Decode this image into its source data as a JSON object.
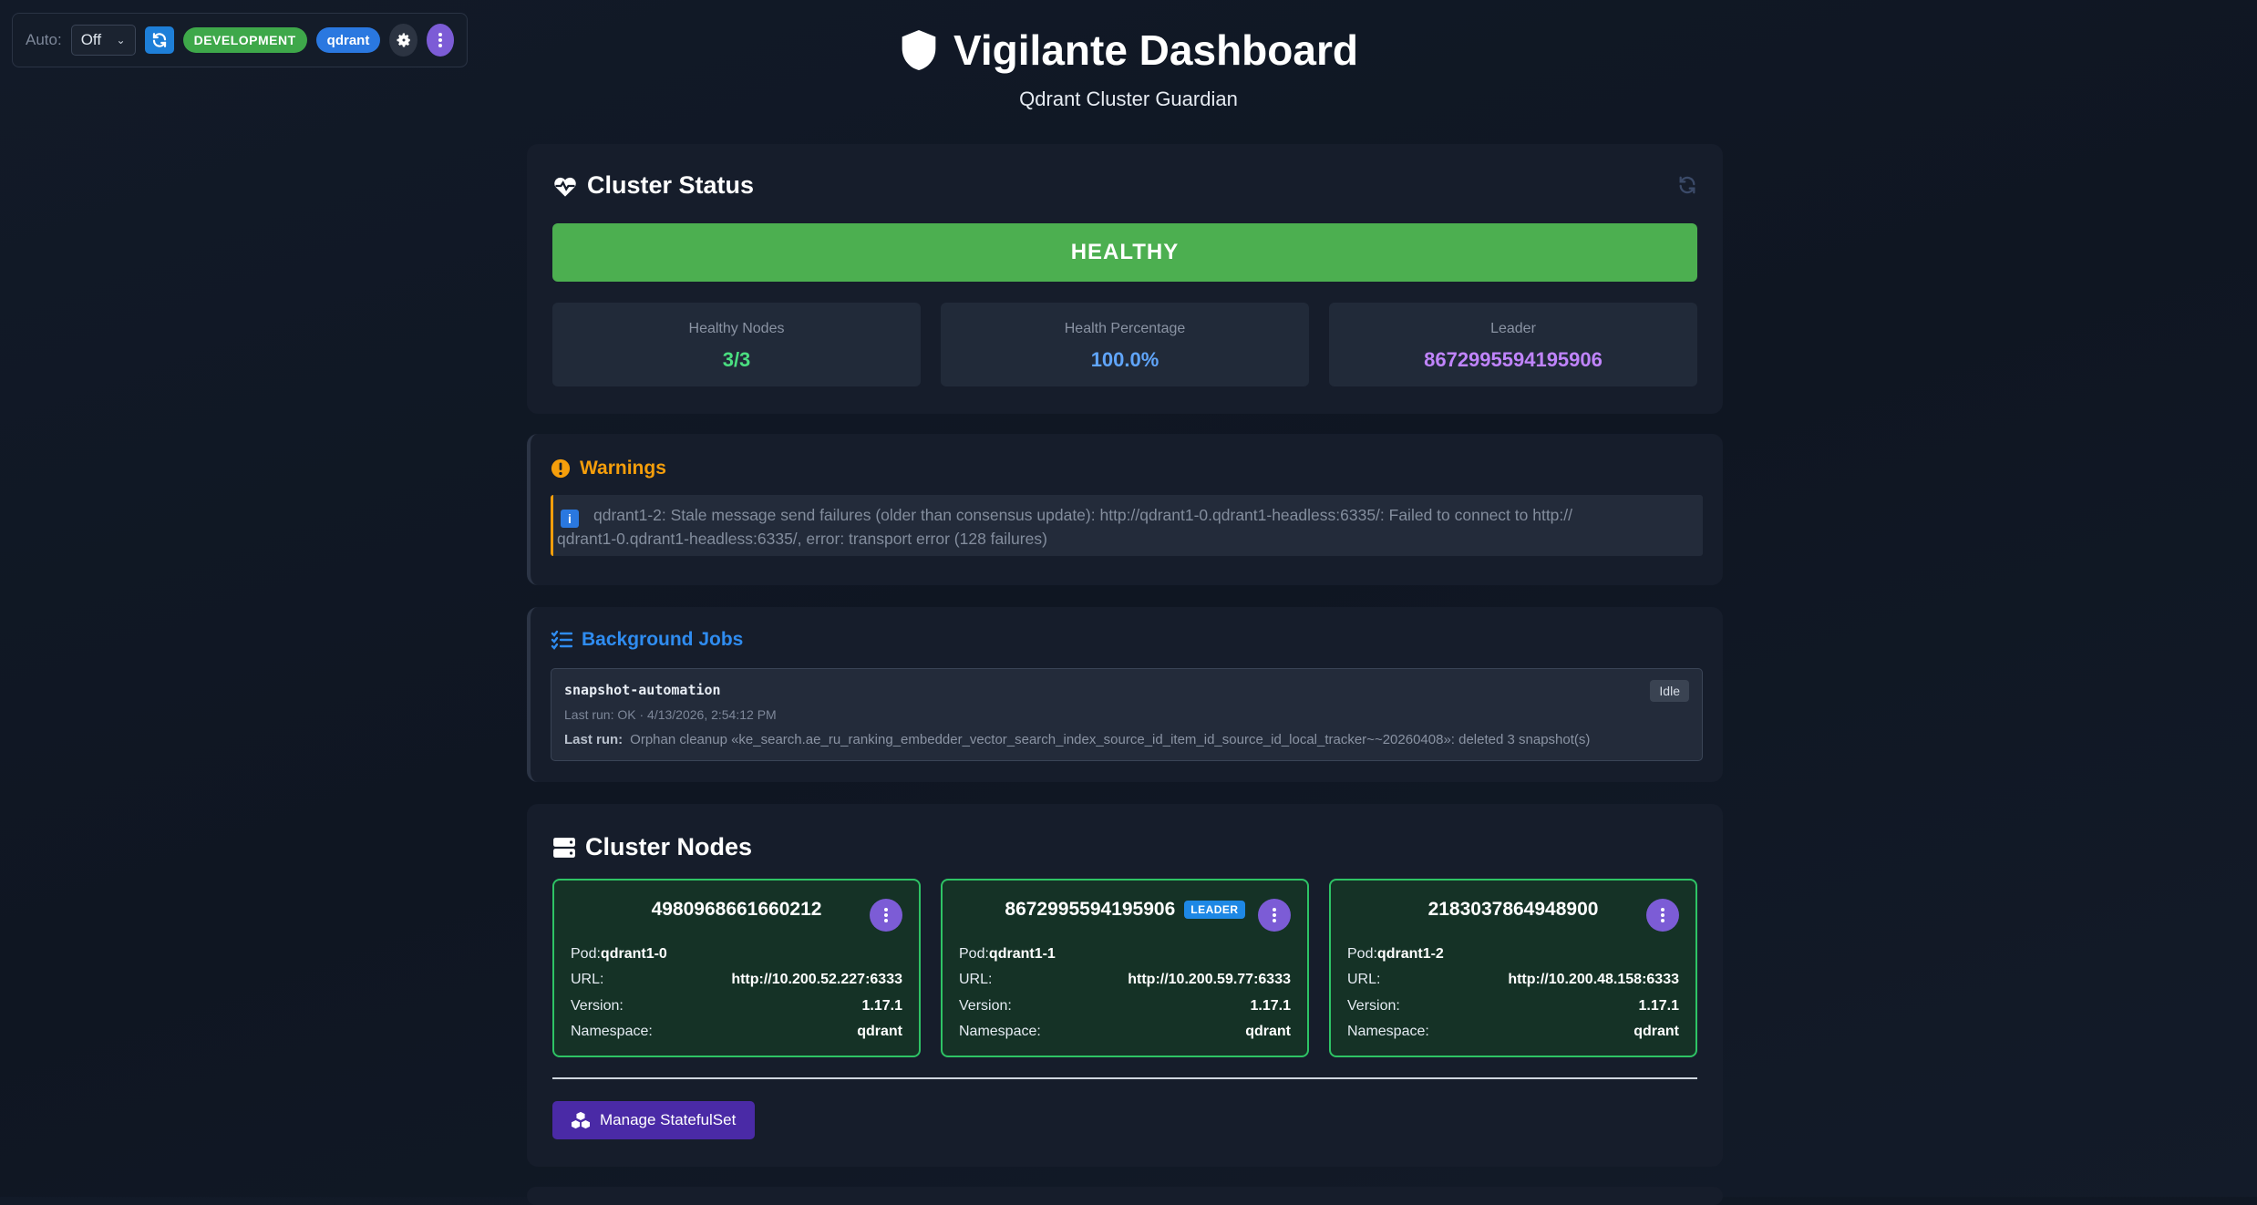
{
  "toolbar": {
    "auto_label": "Auto:",
    "auto_value": "Off",
    "env_badge": "DEVELOPMENT",
    "service_badge": "qdrant"
  },
  "header": {
    "title": "Vigilante Dashboard",
    "subtitle": "Qdrant Cluster Guardian"
  },
  "cluster_status": {
    "title": "Cluster Status",
    "health": "HEALTHY",
    "stats": [
      {
        "label": "Healthy Nodes",
        "value": "3/3",
        "color": "#4ade80"
      },
      {
        "label": "Health Percentage",
        "value": "100.0%",
        "color": "#60a5fa"
      },
      {
        "label": "Leader",
        "value": "8672995594195906",
        "color": "#c084fc"
      }
    ]
  },
  "warnings": {
    "title": "Warnings",
    "items": [
      {
        "line1": "qdrant1-2: Stale message send failures (older than consensus update): http://qdrant1-0.qdrant1-headless:6335/: Failed to connect to http://",
        "line2": "qdrant1-0.qdrant1-headless:6335/, error: transport error (128 failures)"
      }
    ]
  },
  "jobs": {
    "title": "Background Jobs",
    "items": [
      {
        "name": "snapshot-automation",
        "status": "Idle",
        "last_run_summary": "Last run: OK · 4/13/2026, 2:54:12 PM",
        "last_run_label": "Last run:",
        "last_run_detail": "Orphan cleanup «ke_search.ae_ru_ranking_embedder_vector_search_index_source_id_item_id_source_id_local_tracker~~20260408»: deleted 3 snapshot(s)"
      }
    ]
  },
  "nodes": {
    "title": "Cluster Nodes",
    "leader_label": "LEADER",
    "pod_label": "Pod:",
    "url_label": "URL:",
    "version_label": "Version:",
    "namespace_label": "Namespace:",
    "items": [
      {
        "id": "4980968661660212",
        "pod": "qdrant1-0",
        "url": "http://10.200.52.227:6333",
        "version": "1.17.1",
        "namespace": "qdrant",
        "leader": false
      },
      {
        "id": "8672995594195906",
        "pod": "qdrant1-1",
        "url": "http://10.200.59.77:6333",
        "version": "1.17.1",
        "namespace": "qdrant",
        "leader": true
      },
      {
        "id": "2183037864948900",
        "pod": "qdrant1-2",
        "url": "http://10.200.48.158:6333",
        "version": "1.17.1",
        "namespace": "qdrant",
        "leader": false
      }
    ],
    "manage_button": "Manage StatefulSet"
  },
  "colors": {
    "healthy": "#4caf50",
    "warning": "#f59e0b",
    "accent_blue": "#2f8cf0",
    "node_border": "#2ec365",
    "manage_button": "#4a2aa6"
  }
}
